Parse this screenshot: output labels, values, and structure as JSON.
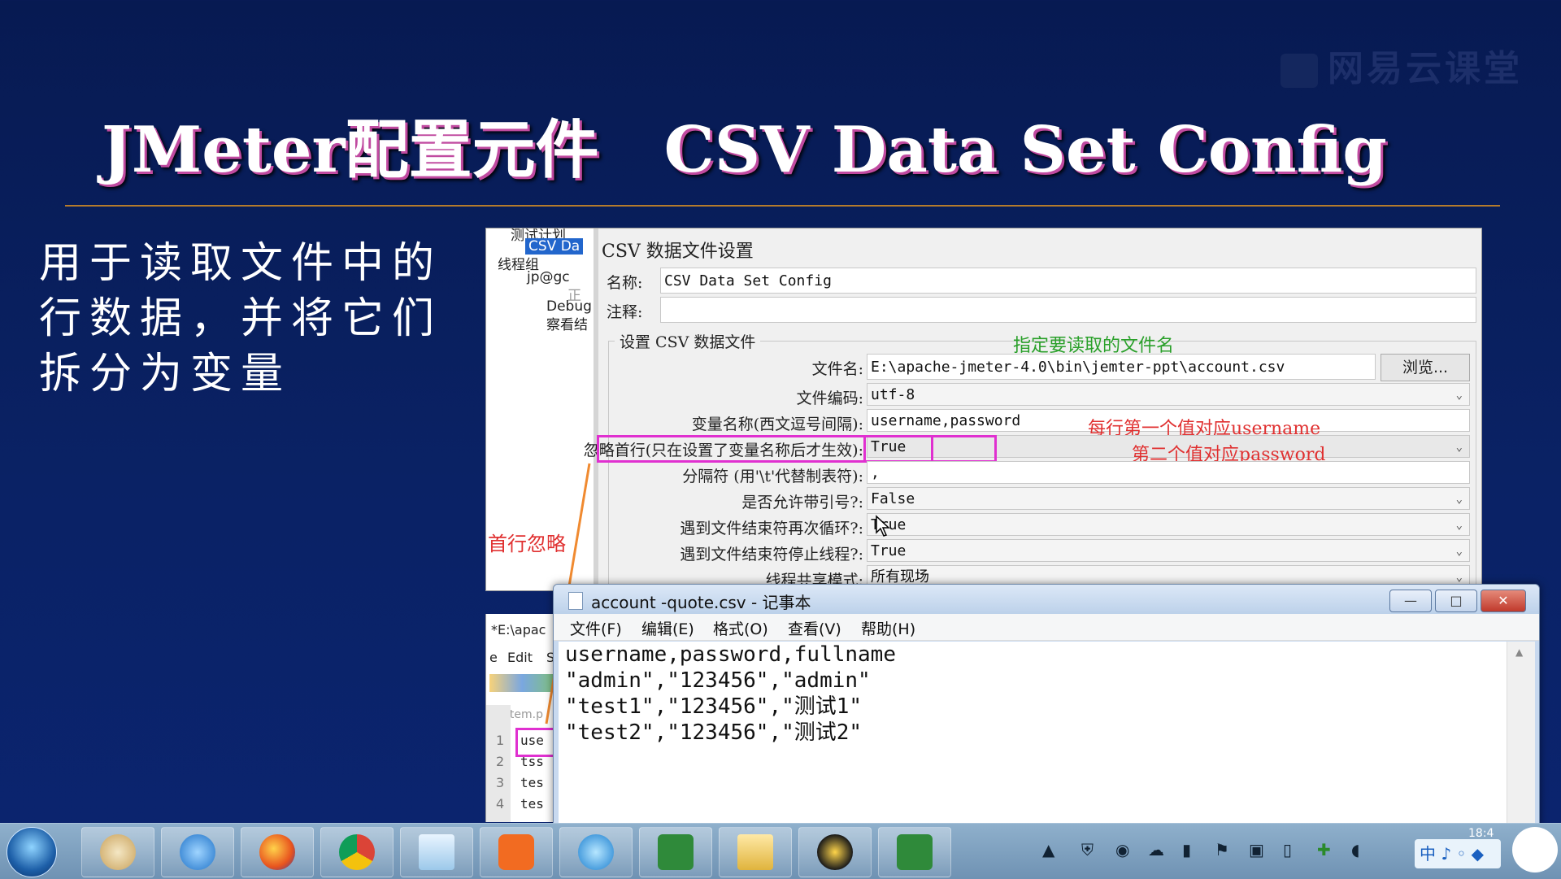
{
  "slide": {
    "logo": "网易云课堂",
    "title_cn": "JMeter配置元件",
    "title_en": "CSV Data Set Config",
    "description": "用于读取文件中的行数据，并将它们拆分为变量"
  },
  "jmeter": {
    "tree": {
      "items": [
        "测试计划",
        "CSV Da",
        "线程组",
        "jp@gc",
        "正",
        "Debug",
        "察看结"
      ]
    },
    "panel_title": "CSV 数据文件设置",
    "name_label": "名称:",
    "name_value": "CSV Data Set Config",
    "comment_label": "注释:",
    "group_title": "设置 CSV 数据文件",
    "fields": [
      {
        "label": "文件名:",
        "value": "E:\\apache-jmeter-4.0\\bin\\jemter-ppt\\account.csv"
      },
      {
        "label": "文件编码:",
        "value": "utf-8"
      },
      {
        "label": "变量名称(西文逗号间隔):",
        "value": "username,password"
      },
      {
        "label": "忽略首行(只在设置了变量名称后才生效):",
        "value": "True"
      },
      {
        "label": "分隔符 (用'\\t'代替制表符):",
        "value": ","
      },
      {
        "label": "是否允许带引号?:",
        "value": "False"
      },
      {
        "label": "遇到文件结束符再次循环?:",
        "value": "True"
      },
      {
        "label": "遇到文件结束符停止线程?:",
        "value": "True"
      },
      {
        "label": "线程共享模式:",
        "value": "所有现场"
      }
    ],
    "browse_label": "浏览...",
    "annotations": {
      "filename": "指定要读取的文件名",
      "first_value": "每行第一个值对应username",
      "second_value": "第二个值对应password",
      "first_line_ignored": "首行忽略"
    },
    "colors": {
      "highlight": "#e030d0",
      "annotation_green": "#2aa02a",
      "annotation_red": "#e03030"
    }
  },
  "editor": {
    "title": "*E:\\apac",
    "menu": [
      "e",
      "Edit",
      "S"
    ],
    "tab": "system.p",
    "lines": [
      {
        "num": "1",
        "text": "use"
      },
      {
        "num": "2",
        "text": "tss"
      },
      {
        "num": "3",
        "text": "tes"
      },
      {
        "num": "4",
        "text": "tes"
      }
    ]
  },
  "notepad": {
    "title": "account -quote.csv - 记事本",
    "menu": [
      "文件(F)",
      "编辑(E)",
      "格式(O)",
      "查看(V)",
      "帮助(H)"
    ],
    "lines": [
      "username,password,fullname",
      "\"admin\",\"123456\",\"admin\"",
      "\"test1\",\"123456\",\"测试1\"",
      "\"test2\",\"123456\",\"测试2\""
    ],
    "buttons": {
      "minimize": "—",
      "maximize": "□",
      "close": "✕"
    }
  },
  "taskbar": {
    "apps": [
      "start-orb",
      "paint-icon",
      "ie-icon",
      "firefox-icon",
      "chrome-icon",
      "notes-icon",
      "powerpoint-icon",
      "browser-icon",
      "camtasia-icon",
      "explorer-icon",
      "ultraedit-icon",
      "camtasia2-icon"
    ],
    "ime": "中 ♪ ◦ ◆",
    "clock": "18:4"
  }
}
